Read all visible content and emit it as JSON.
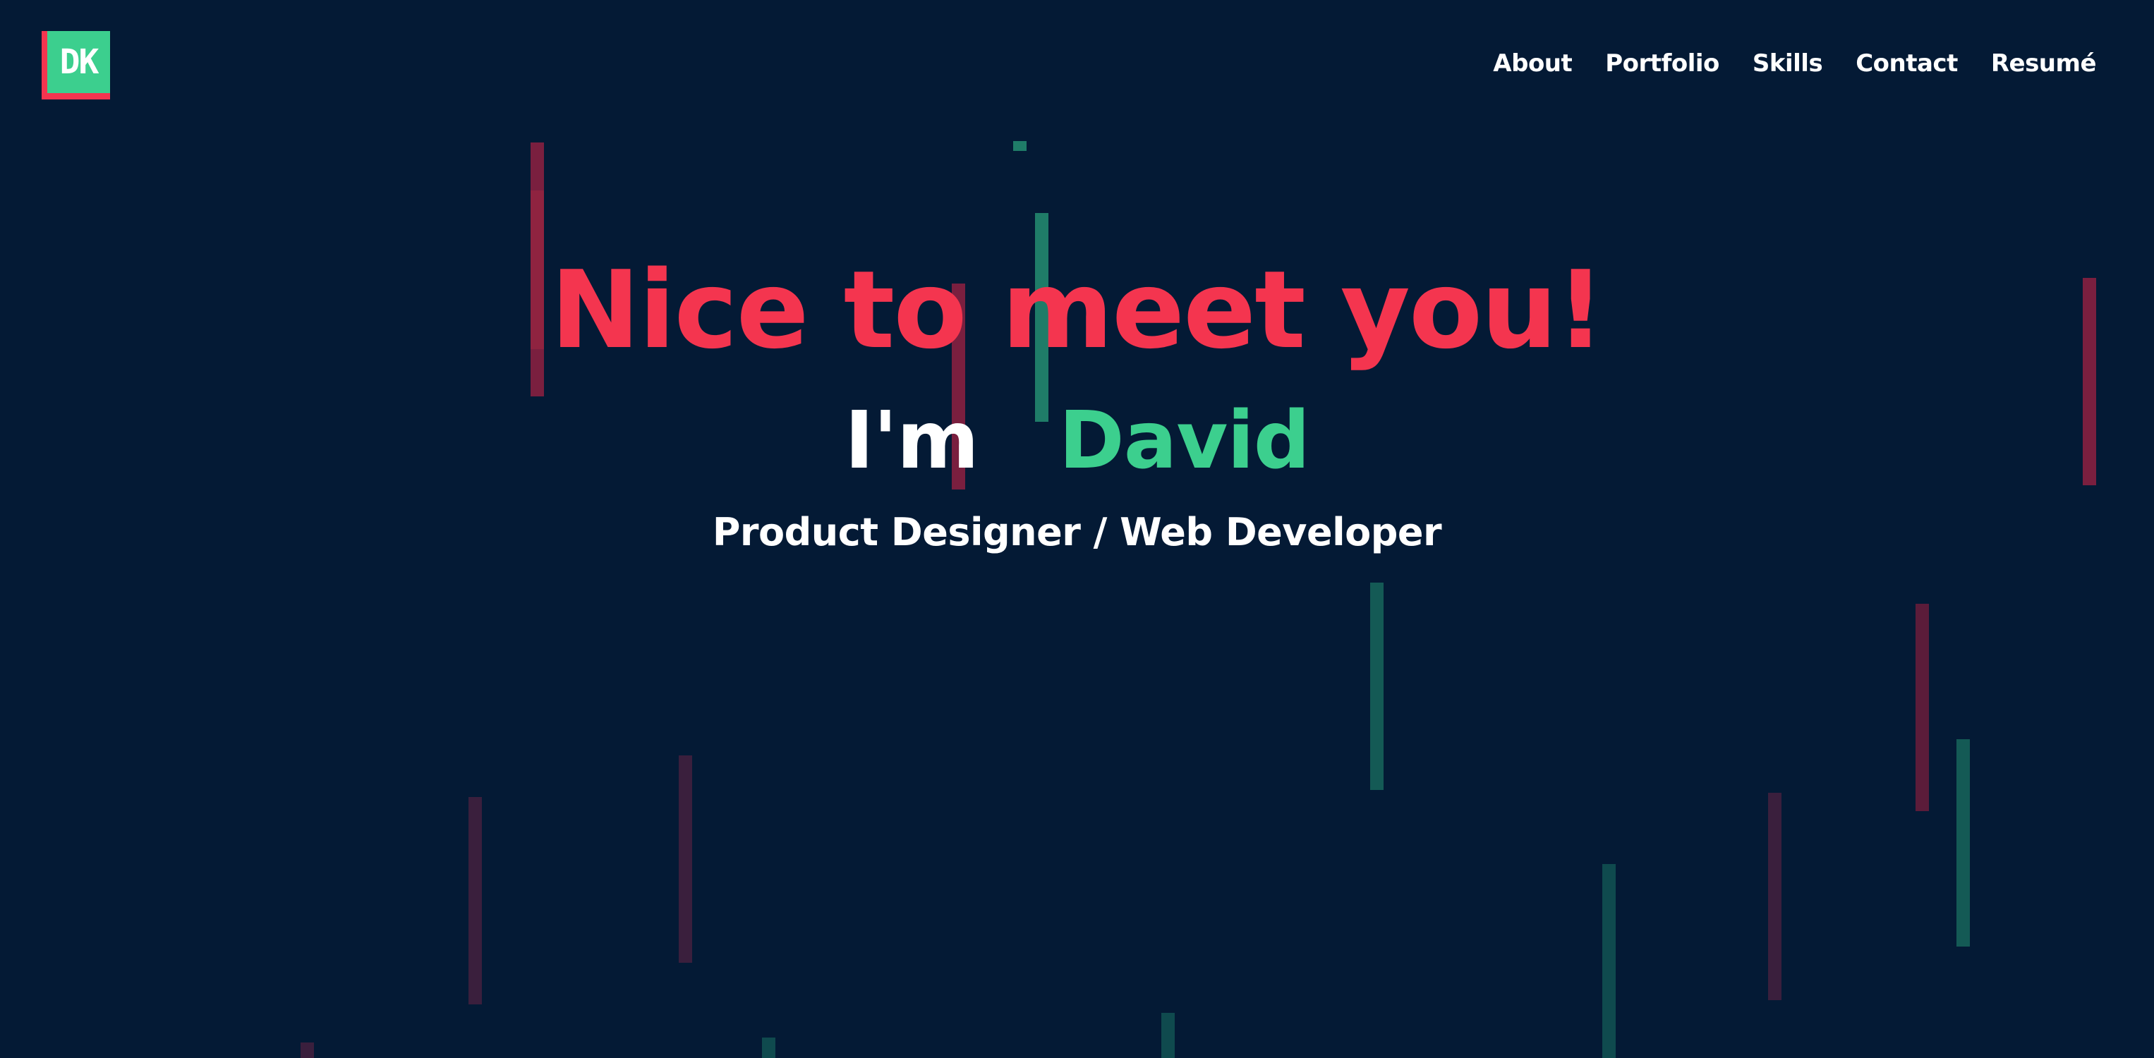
{
  "header": {
    "logo_text": "DK",
    "nav": [
      {
        "label": "About"
      },
      {
        "label": "Portfolio"
      },
      {
        "label": "Skills"
      },
      {
        "label": "Contact"
      },
      {
        "label": "Resumé"
      }
    ]
  },
  "hero": {
    "headline": "Nice to meet you!",
    "intro_prefix": "I'm",
    "intro_name": "David",
    "tagline": "Product Designer / Web Developer"
  },
  "colors": {
    "background": "#041a35",
    "accent_red": "#f4354f",
    "accent_green": "#3ccf8e",
    "text": "#ffffff"
  }
}
